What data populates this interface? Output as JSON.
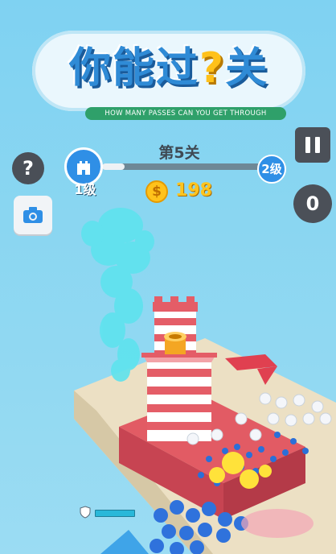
{
  "logo": {
    "title_main": "你能过",
    "title_q": "?",
    "title_end": "关",
    "subtitle": "HOW MANY PASSES CAN YOU GET THROUGH"
  },
  "hud": {
    "help_label": "?",
    "level_title": "第5关",
    "current_level": "1级",
    "next_level": "2级",
    "level_progress": 0.14,
    "coin_symbol": "$",
    "coins": "198",
    "power_count": "0",
    "health_fill": 1.0
  },
  "colors": {
    "accent_blue": "#2f8fe6",
    "coin_gold": "#ffc21b",
    "enemy_red": "#e04050",
    "crowd_blue": "#2b6fd8",
    "sky": "#8ad6f1"
  },
  "icons": {
    "help": "question-mark-icon",
    "camera": "camera-icon",
    "pause": "pause-icon",
    "power": "power-icon",
    "level": "castle-icon",
    "coin": "coin-icon",
    "shield": "shield-icon"
  }
}
